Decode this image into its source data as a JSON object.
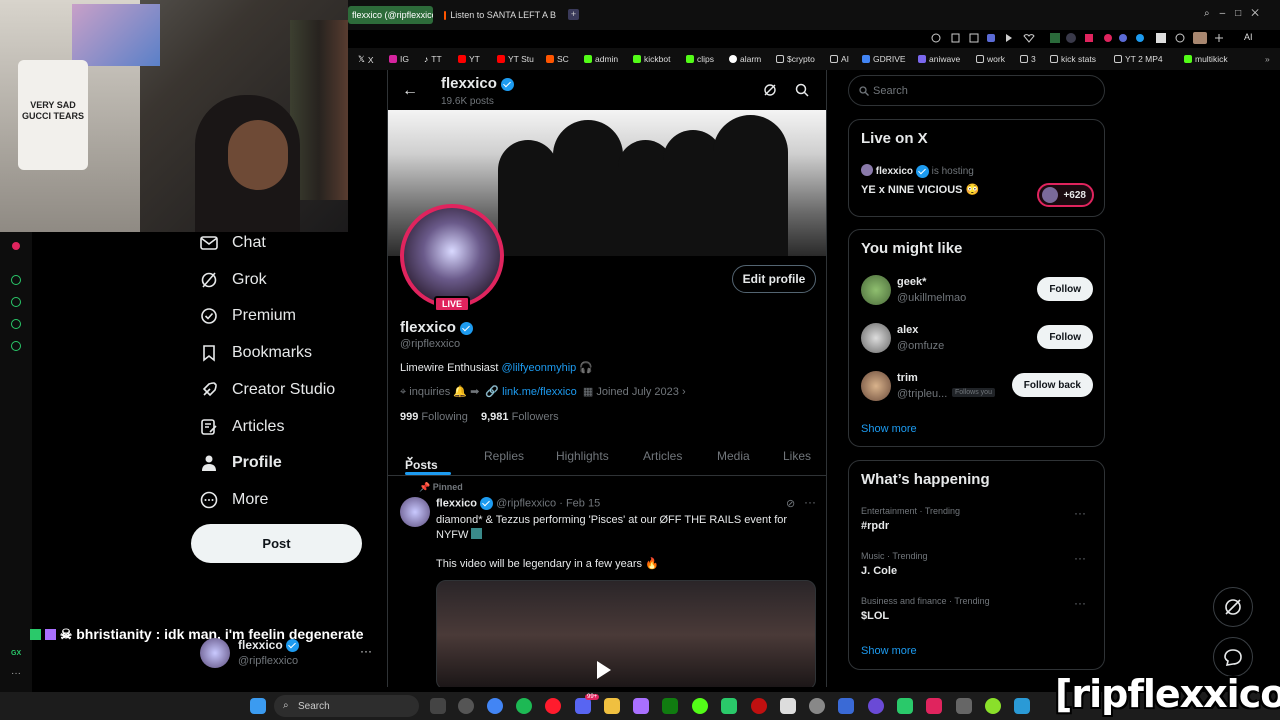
{
  "webcam": {
    "shirt_text": "VERY SAD\nGUCCI TEARS"
  },
  "browser": {
    "tabs": [
      {
        "label": "flexxico (@ripflexxico",
        "active": true
      },
      {
        "label": "Listen to SANTA LEFT A B",
        "active": false
      }
    ],
    "bookmarks": [
      "X",
      "IG",
      "TT",
      "YT",
      "YT Stu",
      "SC",
      "admin",
      "kickbot",
      "clips",
      "alarm",
      "$crypto",
      "AI",
      "GDRIVE",
      "aniwave",
      "work",
      "3",
      "kick stats",
      "YT 2 MP4",
      "multikick"
    ],
    "ai_label": "AI"
  },
  "nav": {
    "items": [
      {
        "name": "chat",
        "label": "Chat"
      },
      {
        "name": "grok",
        "label": "Grok"
      },
      {
        "name": "premium",
        "label": "Premium"
      },
      {
        "name": "bookmarks",
        "label": "Bookmarks"
      },
      {
        "name": "creator-studio",
        "label": "Creator Studio"
      },
      {
        "name": "articles",
        "label": "Articles"
      },
      {
        "name": "profile",
        "label": "Profile"
      },
      {
        "name": "more",
        "label": "More"
      }
    ],
    "post_label": "Post",
    "account": {
      "name": "flexxico",
      "handle": "@ripflexxico"
    }
  },
  "chat_overlay": {
    "text": "bhristianity : idk man. i'm feelin degenerate"
  },
  "profile": {
    "header_name": "flexxico",
    "post_count": "19.6K posts",
    "live_badge": "LIVE",
    "edit_label": "Edit profile",
    "name": "flexxico",
    "handle": "@ripflexxico",
    "bio_text": "Limewire Enthusiast",
    "bio_link": "@lilfyeonmyhip",
    "location": "inquiries",
    "website": "link.me/flexxico",
    "joined": "Joined July 2023",
    "following_count": "999",
    "following_label": "Following",
    "followers_count": "9,981",
    "followers_label": "Followers",
    "tabs": [
      "Posts",
      "Replies",
      "Highlights",
      "Articles",
      "Media",
      "Likes"
    ]
  },
  "pinned_post": {
    "pinned_label": "Pinned",
    "author": "flexxico",
    "handle_date": "@ripflexxico · Feb 15",
    "text": "diamond* & Tezzus performing 'Pisces' at our ØFF THE RAILS event for NYFW",
    "text2": "This video will be legendary in a few years"
  },
  "sidebar": {
    "search_placeholder": "Search",
    "live": {
      "title": "Live on X",
      "host": "flexxico",
      "host_suffix": "is hosting",
      "space_title": "YE x NINE VICIOUS",
      "listeners": "+628"
    },
    "suggest": {
      "title": "You might like",
      "users": [
        {
          "name": "geek*",
          "handle": "@ukillmelmao",
          "button": "Follow",
          "badge": ""
        },
        {
          "name": "alex",
          "handle": "@omfuze",
          "button": "Follow",
          "badge": ""
        },
        {
          "name": "trim",
          "handle": "@tripleu...",
          "button": "Follow back",
          "badge": "Follows you"
        }
      ],
      "show_more": "Show more"
    },
    "trends": {
      "title": "What’s happening",
      "items": [
        {
          "meta": "Entertainment · Trending",
          "name": "#rpdr"
        },
        {
          "meta": "Music · Trending",
          "name": "J. Cole"
        },
        {
          "meta": "Business and finance · Trending",
          "name": "$LOL"
        }
      ],
      "show_more": "Show more"
    }
  },
  "taskbar": {
    "search_label": "Search",
    "badge": "99+"
  },
  "watermark": "[ripflexxico]",
  "colors": {
    "accent": "#1d9bf0",
    "live": "#e0245e",
    "background": "#000000"
  }
}
